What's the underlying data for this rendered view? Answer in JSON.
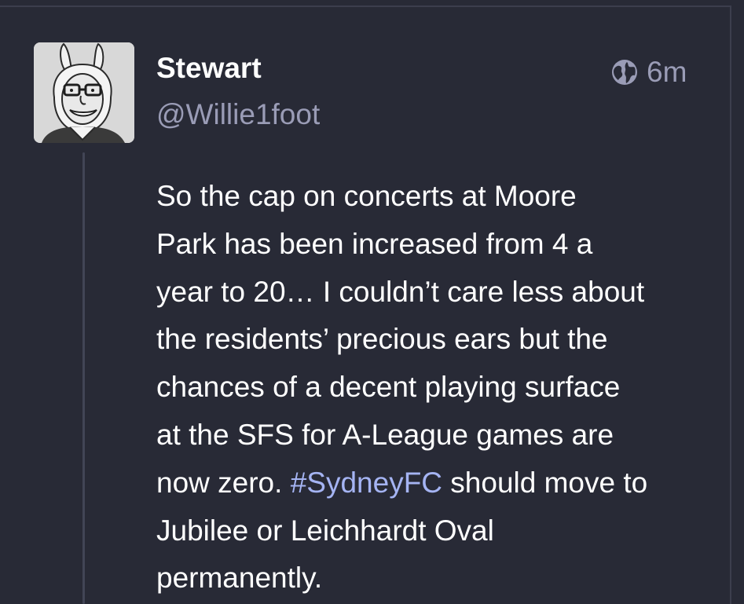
{
  "post": {
    "author": {
      "display_name": "Stewart",
      "handle": "@Willie1foot",
      "avatar_icon": "cartoon-bunny-avatar"
    },
    "visibility_icon": "globe-icon",
    "timestamp": "6m",
    "content": {
      "lines": [
        "So the cap on concerts at Moore",
        "Park has been increased from 4 a",
        "year to 20… I couldn’t care less about",
        "the residents’ precious ears but the",
        "chances of a decent playing surface",
        "at the SFS for A-League games are"
      ],
      "line7_before": "now zero. ",
      "hashtag": "#SydneyFC",
      "line7_after": " should move to",
      "lines_end": [
        "Jubilee or Leichhardt Oval",
        "permanently."
      ]
    }
  },
  "colors": {
    "background": "#282a36",
    "text": "#ffffff",
    "muted": "#9a9cb6",
    "hashtag": "#a5b4f3",
    "thread_line": "#424556"
  }
}
